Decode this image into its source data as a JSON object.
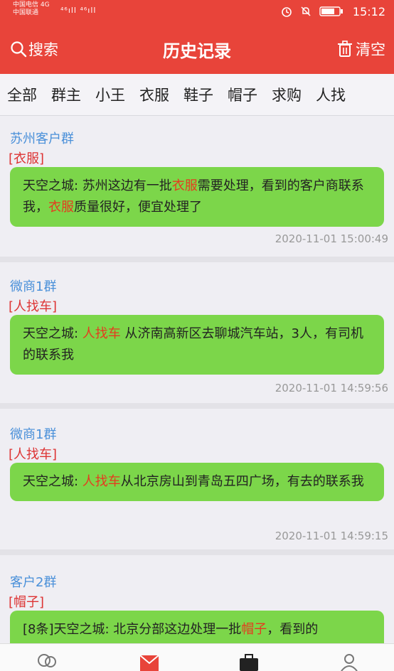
{
  "status_bar": {
    "carrier1": "中国电信 4G",
    "carrier2": "中国联通",
    "signal_text": "⁴⁶ıll ⁴⁶ıll",
    "time": "15:12",
    "battery_level": 0.75
  },
  "header": {
    "search_label": "搜索",
    "title": "历史记录",
    "clear_label": "清空",
    "color": "#e8443a"
  },
  "tabs": [
    "全部",
    "群主",
    "小王",
    "衣服",
    "鞋子",
    "帽子",
    "求购",
    "人找"
  ],
  "messages": [
    {
      "group": "苏州客户群",
      "tag": "[衣服]",
      "parts": [
        "天空之城: 苏州这边有一批",
        "衣服",
        "需要处理，看到的客户商联系我，",
        "衣服",
        "质量很好，便宜处理了"
      ],
      "time": "2020-11-01 15:00:49"
    },
    {
      "group": "微商1群",
      "tag": "[人找车]",
      "parts": [
        "天空之城: ",
        "人找车",
        " 从济南高新区去聊城汽车站，3人，有司机的联系我"
      ],
      "time": "2020-11-01 14:59:56"
    },
    {
      "group": "微商1群",
      "tag": "[人找车]",
      "parts": [
        "天空之城: ",
        "人找车",
        "从北京房山到青岛五四广场，有去的联系我"
      ],
      "time": "2020-11-01 14:59:15"
    },
    {
      "group": "客户2群",
      "tag": "[帽子]",
      "parts": [
        "[8条]天空之城: 北京分部这边处理一批",
        "帽子",
        "，看到的"
      ],
      "time": ""
    }
  ],
  "icons": {
    "status": [
      "alarm-icon",
      "mute-icon",
      "battery-icon"
    ],
    "tabbar": [
      "chat-bubbles-icon",
      "mail-icon",
      "briefcase-icon",
      "user-icon"
    ]
  }
}
